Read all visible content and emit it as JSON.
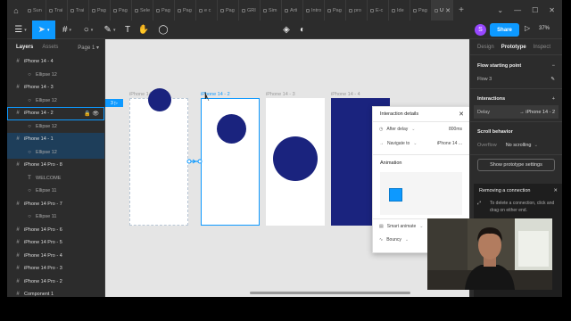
{
  "tabs": [
    "Sun",
    "Trai",
    "Trai",
    "Pag",
    "Pag",
    "Sele",
    "Pag",
    "Pag",
    "e c",
    "Pag",
    "GRI",
    "Sim",
    "Arti",
    "Intro",
    "Pag",
    "pro",
    "E-c",
    "Ide",
    "Pag",
    "U"
  ],
  "active_tab_index": 19,
  "toolbar": {
    "avatar": "S",
    "share": "Share",
    "zoom": "37%"
  },
  "left_panel": {
    "tab_layers": "Layers",
    "tab_assets": "Assets",
    "page": "Page 1",
    "layers": [
      {
        "name": "iPhone 14 - 4",
        "kind": "frame"
      },
      {
        "name": "Ellipse 12",
        "kind": "child"
      },
      {
        "name": "iPhone 14 - 3",
        "kind": "frame"
      },
      {
        "name": "Ellipse 12",
        "kind": "child"
      },
      {
        "name": "iPhone 14 - 2",
        "kind": "frame",
        "selected": true
      },
      {
        "name": "Ellipse 12",
        "kind": "child"
      },
      {
        "name": "iPhone 14 - 1",
        "kind": "frame",
        "highlight": true
      },
      {
        "name": "Ellipse 12",
        "kind": "child",
        "highlight": true
      },
      {
        "name": "iPhone 14 Pro - 8",
        "kind": "frame"
      },
      {
        "name": "WELCOME",
        "kind": "text"
      },
      {
        "name": "Ellipse 11",
        "kind": "child"
      },
      {
        "name": "iPhone 14 Pro - 7",
        "kind": "frame"
      },
      {
        "name": "Ellipse 11",
        "kind": "child"
      },
      {
        "name": "iPhone 14 Pro - 6",
        "kind": "frame"
      },
      {
        "name": "iPhone 14 Pro - 5",
        "kind": "frame"
      },
      {
        "name": "iPhone 14 Pro - 4",
        "kind": "frame"
      },
      {
        "name": "iPhone 14 Pro - 3",
        "kind": "frame"
      },
      {
        "name": "iPhone 14 Pro - 2",
        "kind": "frame"
      },
      {
        "name": "Component 1",
        "kind": "frame"
      }
    ]
  },
  "canvas": {
    "flow_tag": "3",
    "frames": [
      {
        "label": "iPhone 14 - 1"
      },
      {
        "label": "iPhone 14 - 2",
        "selected": true
      },
      {
        "label": "iPhone 14 - 3"
      },
      {
        "label": "iPhone 14 - 4"
      }
    ]
  },
  "dialog": {
    "title": "Interaction details",
    "trigger": "After delay",
    "trigger_value": "800ms",
    "action": "Navigate to",
    "action_value": "iPhone 14 ...",
    "animation_label": "Animation",
    "animation_type": "Smart animate",
    "easing": "Bouncy"
  },
  "right_panel": {
    "tab_design": "Design",
    "tab_prototype": "Prototype",
    "tab_inspect": "Inspect",
    "flow_heading": "Flow starting point",
    "flow_name": "Flow 3",
    "interactions_heading": "Interactions",
    "interaction_trigger": "Delay",
    "interaction_target": "iPhone 14 - 2",
    "scroll_heading": "Scroll behavior",
    "overflow_label": "Overflow",
    "overflow_value": "No scrolling",
    "settings_button": "Show prototype settings",
    "popup_title": "Removing a connection",
    "popup_text": "To delete a connection, click and drag on either end."
  },
  "colors": {
    "accent": "#0d99ff",
    "circle": "#1a237e"
  }
}
